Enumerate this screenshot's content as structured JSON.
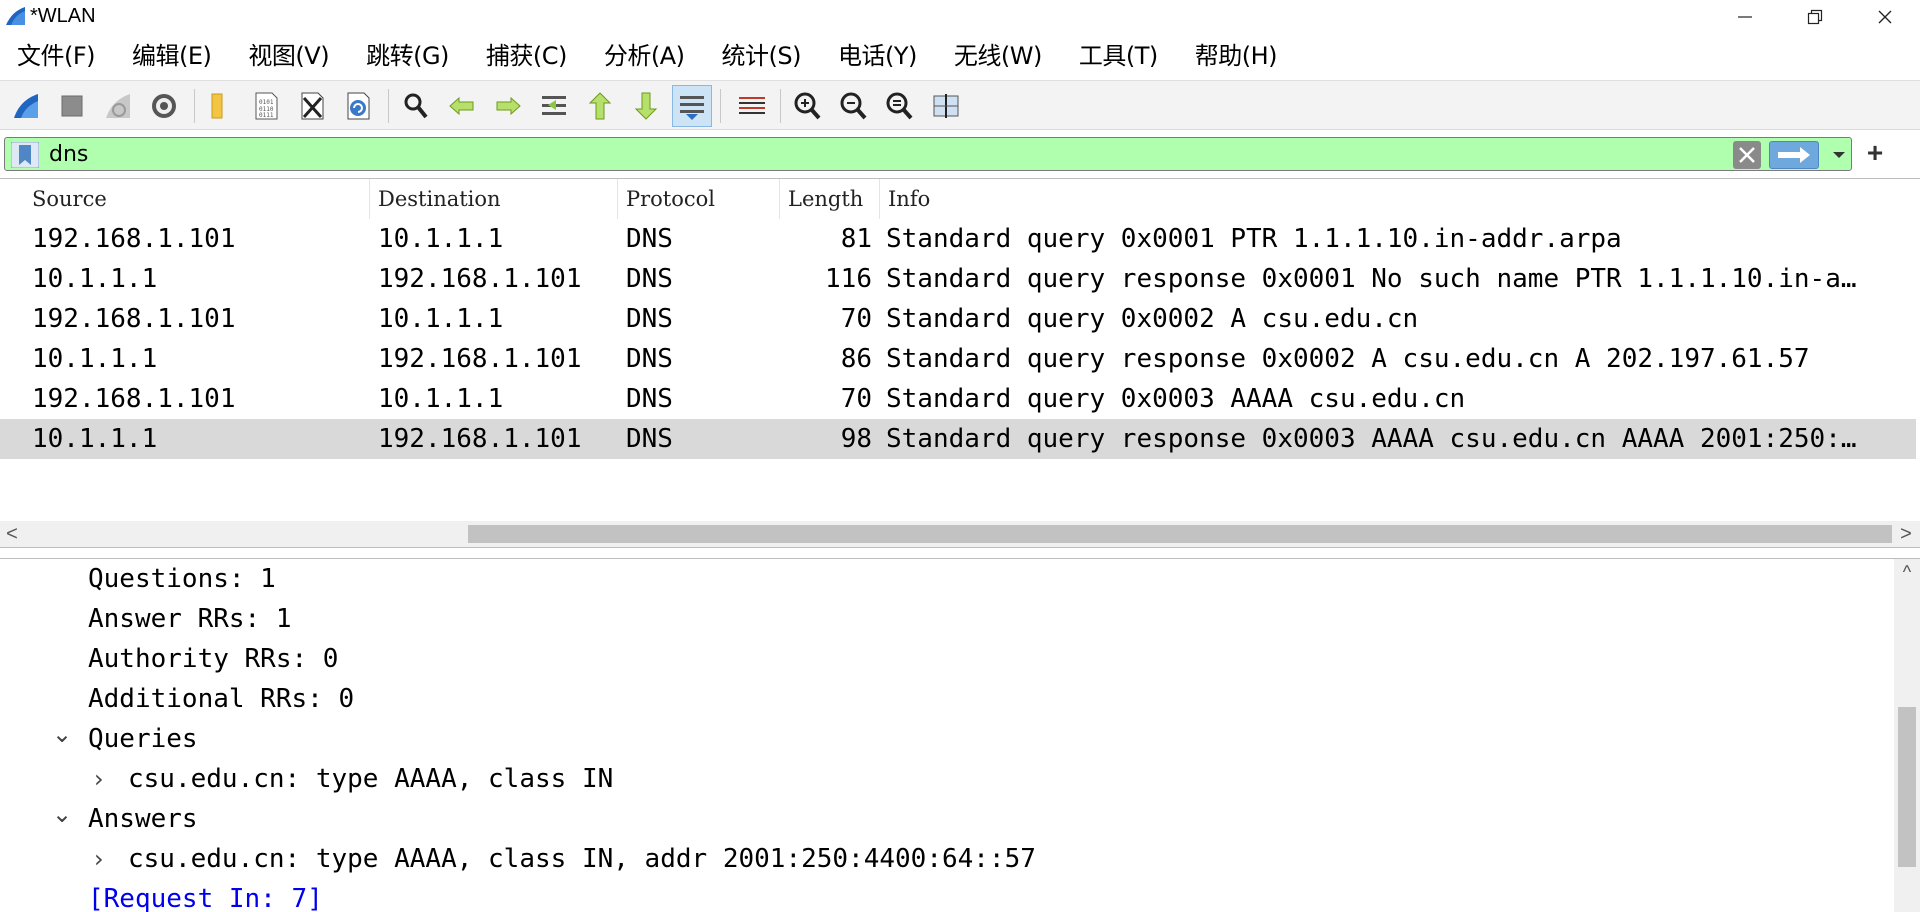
{
  "window": {
    "title": "*WLAN",
    "min_glyph": "—",
    "max_glyph": "❐",
    "close_glyph": "✕"
  },
  "menu": [
    {
      "label": "文件(F)"
    },
    {
      "label": "编辑(E)"
    },
    {
      "label": "视图(V)"
    },
    {
      "label": "跳转(G)"
    },
    {
      "label": "捕获(C)"
    },
    {
      "label": "分析(A)"
    },
    {
      "label": "统计(S)"
    },
    {
      "label": "电话(Y)"
    },
    {
      "label": "无线(W)"
    },
    {
      "label": "工具(T)"
    },
    {
      "label": "帮助(H)"
    }
  ],
  "toolbar": {
    "icons": [
      "start-capture-icon",
      "stop-capture-icon",
      "restart-capture-icon",
      "capture-options-icon",
      "open-file-icon",
      "save-file-icon",
      "close-file-icon",
      "reload-icon",
      "find-packet-icon",
      "go-back-icon",
      "go-forward-icon",
      "go-to-packet-icon",
      "first-packet-icon",
      "last-packet-icon",
      "autoscroll-icon",
      "colorize-icon",
      "zoom-in-icon",
      "zoom-out-icon",
      "normal-size-icon",
      "resize-columns-icon"
    ],
    "active": "autoscroll-icon"
  },
  "filter": {
    "value": "dns",
    "plus_glyph": "+"
  },
  "packet_list": {
    "columns": [
      "Source",
      "Destination",
      "Protocol",
      "Length",
      "Info"
    ],
    "rows": [
      {
        "source": "192.168.1.101",
        "destination": "10.1.1.1",
        "protocol": "DNS",
        "length": "81",
        "info": "Standard query 0x0001 PTR 1.1.1.10.in-addr.arpa",
        "selected": false
      },
      {
        "source": "10.1.1.1",
        "destination": "192.168.1.101",
        "protocol": "DNS",
        "length": "116",
        "info": "Standard query response 0x0001 No such name PTR 1.1.1.10.in-a…",
        "selected": false
      },
      {
        "source": "192.168.1.101",
        "destination": "10.1.1.1",
        "protocol": "DNS",
        "length": "70",
        "info": "Standard query 0x0002 A csu.edu.cn",
        "selected": false
      },
      {
        "source": "10.1.1.1",
        "destination": "192.168.1.101",
        "protocol": "DNS",
        "length": "86",
        "info": "Standard query response 0x0002 A csu.edu.cn A 202.197.61.57",
        "selected": false
      },
      {
        "source": "192.168.1.101",
        "destination": "10.1.1.1",
        "protocol": "DNS",
        "length": "70",
        "info": "Standard query 0x0003 AAAA csu.edu.cn",
        "selected": false
      },
      {
        "source": "10.1.1.1",
        "destination": "192.168.1.101",
        "protocol": "DNS",
        "length": "98",
        "info": "Standard query response 0x0003 AAAA csu.edu.cn AAAA 2001:250:…",
        "selected": true
      }
    ],
    "scroll_left": "<",
    "scroll_right": ">"
  },
  "details": {
    "lines": [
      {
        "text": "Questions: 1",
        "indent": 1,
        "chevron": "",
        "link": false
      },
      {
        "text": "Answer RRs: 1",
        "indent": 1,
        "chevron": "",
        "link": false
      },
      {
        "text": "Authority RRs: 0",
        "indent": 1,
        "chevron": "",
        "link": false
      },
      {
        "text": "Additional RRs: 0",
        "indent": 1,
        "chevron": "",
        "link": false
      },
      {
        "text": "Queries",
        "indent": 1,
        "chevron": "⌄",
        "link": false
      },
      {
        "text": "csu.edu.cn: type AAAA, class IN",
        "indent": 2,
        "chevron": "›",
        "link": false
      },
      {
        "text": "Answers",
        "indent": 1,
        "chevron": "⌄",
        "link": false
      },
      {
        "text": "csu.edu.cn: type AAAA, class IN, addr 2001:250:4400:64::57",
        "indent": 2,
        "chevron": "›",
        "link": false
      },
      {
        "text": "[Request In: 7]",
        "indent": 1,
        "chevron": "",
        "link": true
      }
    ],
    "scroll_up": "^"
  },
  "colors": {
    "filter_bg": "#afffaf",
    "selected_row": "#d9d9d9",
    "link": "#0000ee"
  }
}
